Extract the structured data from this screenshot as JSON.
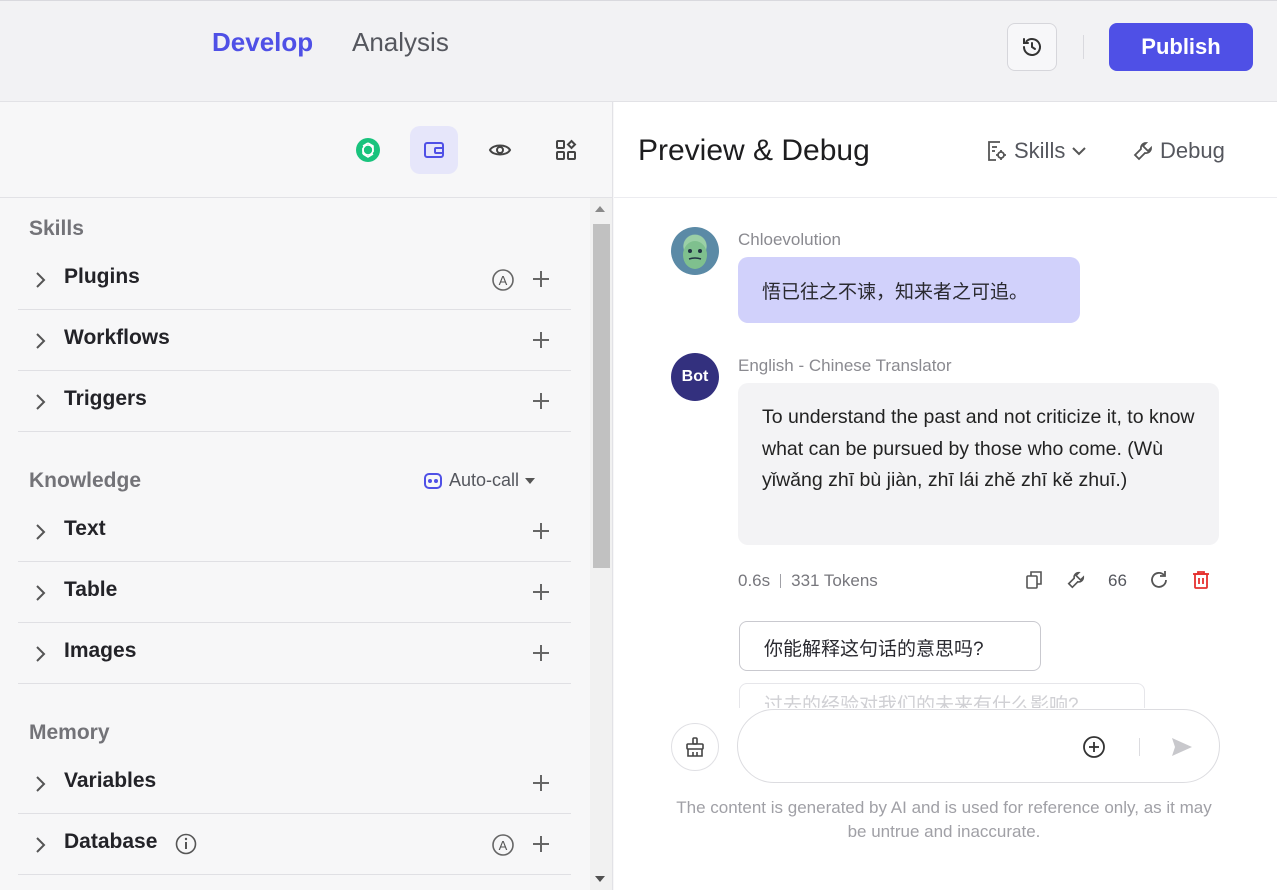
{
  "top_nav": {
    "tabs": [
      {
        "label": "Develop",
        "active": true
      },
      {
        "label": "Analysis",
        "active": false
      }
    ],
    "history_icon": "history-icon",
    "publish_label": "Publish",
    "accent_color": "#4f50e6"
  },
  "left_toolbar": {
    "icons": [
      "openai-model-icon",
      "wallet-icon",
      "eye-icon",
      "apps-grid-icon"
    ],
    "active_index": 1
  },
  "skills": {
    "title": "Skills",
    "items": [
      {
        "label": "Plugins"
      },
      {
        "label": "Workflows"
      },
      {
        "label": "Triggers"
      }
    ]
  },
  "knowledge": {
    "title": "Knowledge",
    "autocall_label": "Auto-call",
    "items": [
      {
        "label": "Text"
      },
      {
        "label": "Table"
      },
      {
        "label": "Images"
      }
    ]
  },
  "memory": {
    "title": "Memory",
    "items": [
      {
        "label": "Variables"
      },
      {
        "label": "Database"
      }
    ]
  },
  "preview": {
    "title": "Preview & Debug",
    "skills_label": "Skills",
    "debug_label": "Debug"
  },
  "chat": {
    "user_name": "Chloevolution",
    "user_message": "悟已往之不谏，知来者之可追。",
    "bot_avatar_label": "Bot",
    "bot_name": "English - Chinese Translator",
    "bot_message": "To understand the past and not criticize it, to know what can be pursued by those who come. (Wù yǐwǎng zhī bù jiàn, zhī lái zhě zhī kě zhuī.)",
    "time": "0.6s",
    "tokens": "331 Tokens",
    "quote_label": "66",
    "suggestions": [
      "你能解释这句话的意思吗?",
      "过去的经验对我们的未来有什么影响?"
    ]
  },
  "input": {
    "placeholder": "",
    "disclaimer": "The content is generated by AI and is used for reference only, as it may be untrue and inaccurate."
  }
}
